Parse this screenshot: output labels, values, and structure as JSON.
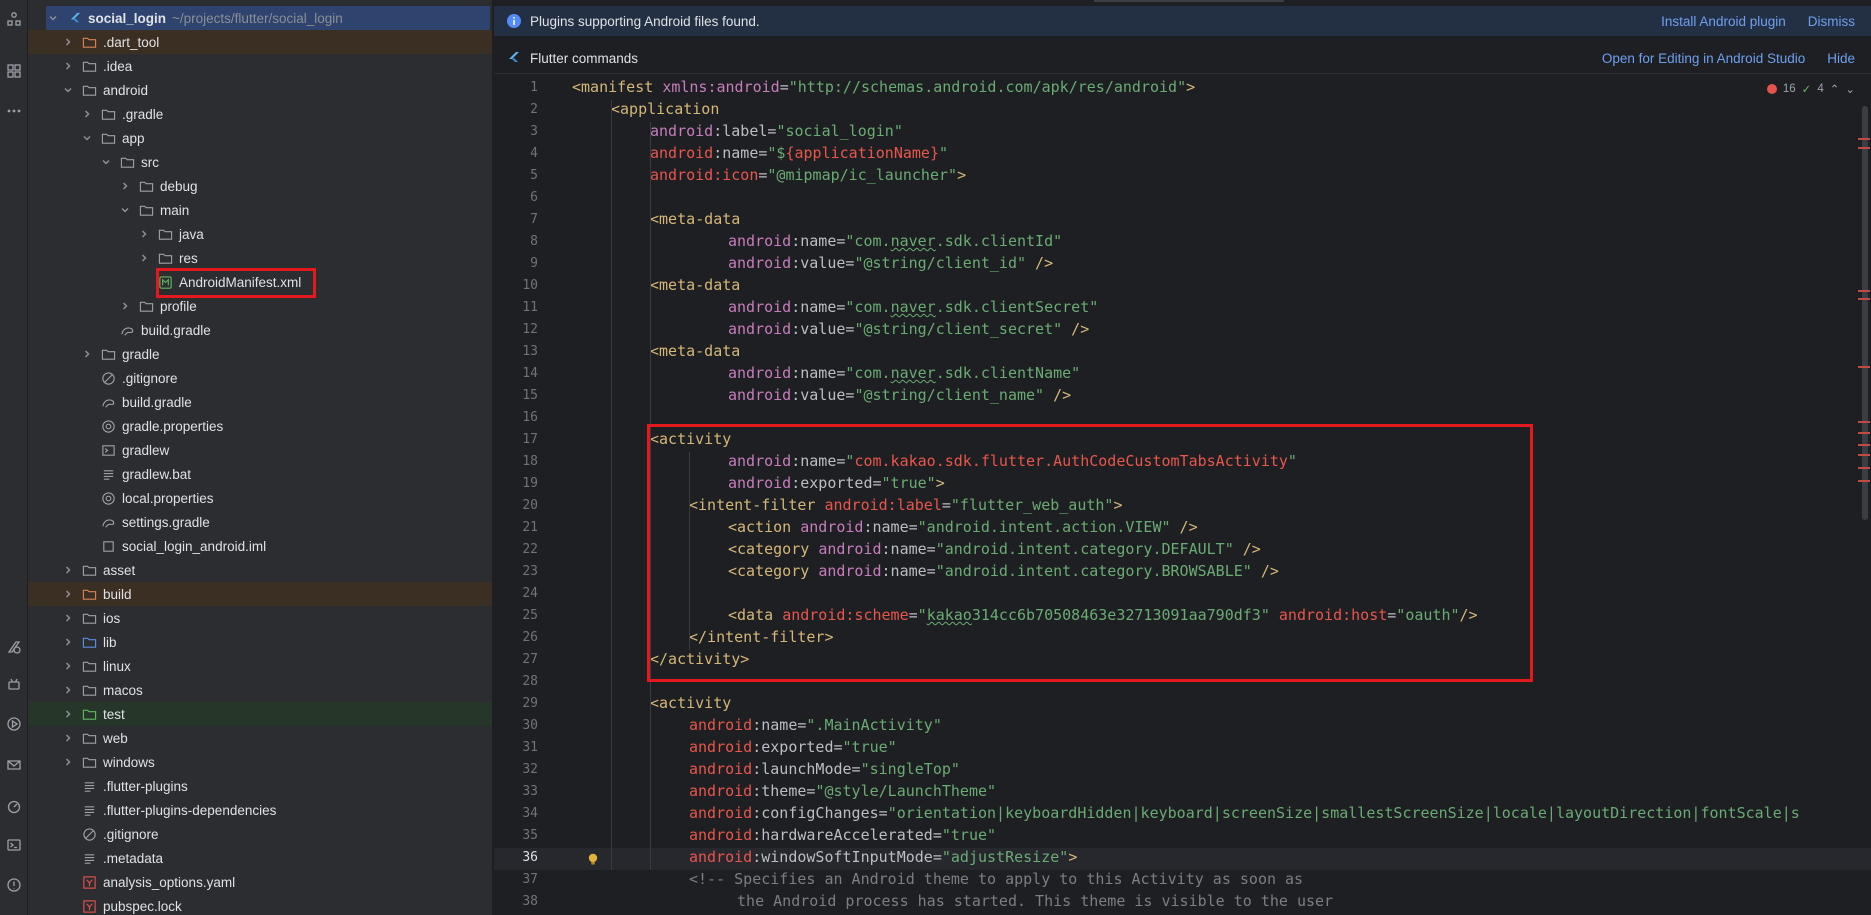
{
  "toolstrip": {
    "icons": [
      "structure-icon",
      "project-icon",
      "more-icon",
      "flutter-inspector-icon",
      "android-icon",
      "run-icon",
      "problems-icon",
      "performance-icon",
      "terminal-icon",
      "notifications-icon"
    ]
  },
  "tree": {
    "root": {
      "name": "social_login",
      "path": "~/projects/flutter/social_login"
    },
    "items": [
      {
        "label": ".dart_tool"
      },
      {
        "label": ".idea"
      },
      {
        "label": "android"
      },
      {
        "label": ".gradle"
      },
      {
        "label": "app"
      },
      {
        "label": "src"
      },
      {
        "label": "debug"
      },
      {
        "label": "main"
      },
      {
        "label": "java"
      },
      {
        "label": "res"
      },
      {
        "label": "AndroidManifest.xml"
      },
      {
        "label": "profile"
      },
      {
        "label": "build.gradle"
      },
      {
        "label": "gradle"
      },
      {
        "label": ".gitignore"
      },
      {
        "label": "build.gradle"
      },
      {
        "label": "gradle.properties"
      },
      {
        "label": "gradlew"
      },
      {
        "label": "gradlew.bat"
      },
      {
        "label": "local.properties"
      },
      {
        "label": "settings.gradle"
      },
      {
        "label": "social_login_android.iml"
      },
      {
        "label": "asset"
      },
      {
        "label": "build"
      },
      {
        "label": "ios"
      },
      {
        "label": "lib"
      },
      {
        "label": "linux"
      },
      {
        "label": "macos"
      },
      {
        "label": "test"
      },
      {
        "label": "web"
      },
      {
        "label": "windows"
      },
      {
        "label": ".flutter-plugins"
      },
      {
        "label": ".flutter-plugins-dependencies"
      },
      {
        "label": ".gitignore"
      },
      {
        "label": ".metadata"
      },
      {
        "label": "analysis_options.yaml"
      },
      {
        "label": "pubspec.lock"
      }
    ]
  },
  "banners": {
    "plugins": {
      "message": "Plugins supporting Android files found.",
      "install": "Install Android plugin",
      "dismiss": "Dismiss"
    },
    "flutter": {
      "message": "Flutter commands",
      "open": "Open for Editing in Android Studio",
      "hide": "Hide"
    }
  },
  "inspections": {
    "errors": "16",
    "warnings": "4"
  },
  "editor": {
    "line_numbers": [
      "1",
      "2",
      "3",
      "4",
      "5",
      "6",
      "7",
      "8",
      "9",
      "10",
      "11",
      "12",
      "13",
      "14",
      "15",
      "16",
      "17",
      "18",
      "19",
      "20",
      "21",
      "22",
      "23",
      "24",
      "25",
      "26",
      "27",
      "28",
      "29",
      "30",
      "31",
      "32",
      "33",
      "34",
      "35",
      "36",
      "37",
      "38"
    ],
    "current_line": "36",
    "colors": {
      "tag": "#d5b778",
      "namespace": "#c77dbb",
      "value": "#6aab73",
      "error": "#e8564c",
      "comment": "#7a7e85"
    }
  }
}
